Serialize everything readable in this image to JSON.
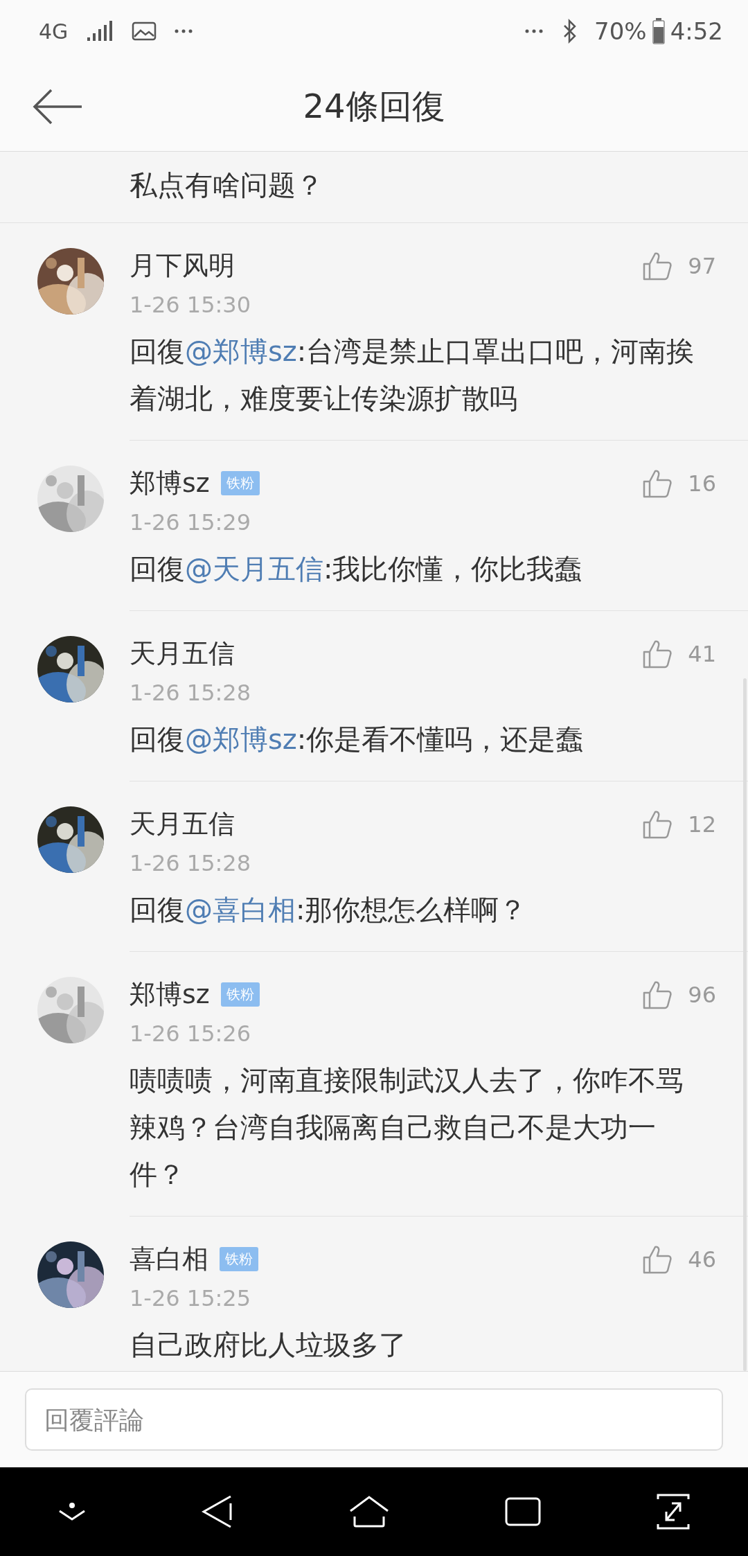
{
  "status_bar": {
    "network": "4G",
    "battery": "70%",
    "time": "4:52"
  },
  "header": {
    "title": "24條回復"
  },
  "partial_comment": {
    "text": "私点有啥问题？"
  },
  "comments": [
    {
      "name": "月下风明",
      "time": "1-26 15:30",
      "likes": "97",
      "reply_prefix": "回復",
      "mention": "@郑博sz",
      "text": ":台湾是禁止口罩出口吧，河南挨着湖北，难度要让传染源扩散吗"
    },
    {
      "name": "郑博sz",
      "badge": "铁粉",
      "time": "1-26 15:29",
      "likes": "16",
      "reply_prefix": "回復",
      "mention": "@天月五信",
      "text": ":我比你懂，你比我蠢"
    },
    {
      "name": "天月五信",
      "time": "1-26 15:28",
      "likes": "41",
      "reply_prefix": "回復",
      "mention": "@郑博sz",
      "text": ":你是看不懂吗，还是蠢"
    },
    {
      "name": "天月五信",
      "time": "1-26 15:28",
      "likes": "12",
      "reply_prefix": "回復",
      "mention": "@喜白相",
      "text": ":那你想怎么样啊？"
    },
    {
      "name": "郑博sz",
      "badge": "铁粉",
      "time": "1-26 15:26",
      "likes": "96",
      "text": "啧啧啧，河南直接限制武汉人去了，你咋不骂辣鸡？台湾自我隔离自己救自己不是大功一件？"
    },
    {
      "name": "喜白相",
      "badge": "铁粉",
      "time": "1-26 15:25",
      "likes": "46",
      "text": "自己政府比人垃圾多了"
    }
  ],
  "reply_field": {
    "placeholder": "回覆評論"
  }
}
